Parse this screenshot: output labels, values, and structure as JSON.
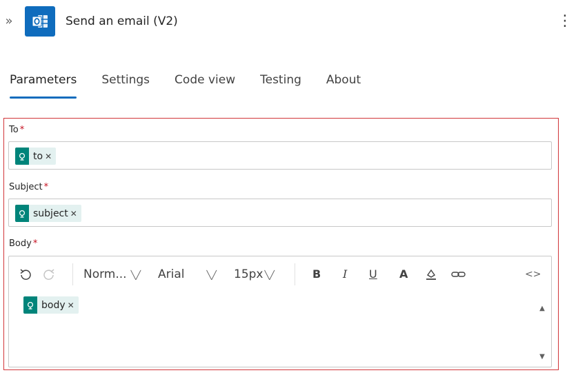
{
  "header": {
    "title": "Send an email (V2)",
    "expand_icon": "double-chevron-right-icon",
    "app_icon": "outlook-icon",
    "more_icon": "more-vertical-icon",
    "app_color": "#0f6cbd"
  },
  "tabs": [
    {
      "label": "Parameters",
      "active": true
    },
    {
      "label": "Settings",
      "active": false
    },
    {
      "label": "Code view",
      "active": false
    },
    {
      "label": "Testing",
      "active": false
    },
    {
      "label": "About",
      "active": false
    }
  ],
  "form": {
    "to": {
      "label": "To",
      "required_mark": "*",
      "token": "to"
    },
    "subject": {
      "label": "Subject",
      "required_mark": "*",
      "token": "subject"
    },
    "body": {
      "label": "Body",
      "required_mark": "*",
      "token": "body"
    }
  },
  "toolbar": {
    "undo_icon": "undo-icon",
    "redo_icon": "redo-icon",
    "block_format": "Norm...",
    "font_family": "Arial",
    "font_size": "15px",
    "bold_label": "B",
    "italic_label": "I",
    "underline_label": "U",
    "font_color_label": "A",
    "highlight_icon": "highlight-icon",
    "link_icon": "link-icon",
    "code_view_label": "<>"
  },
  "colors": {
    "accent": "#0f6cbd",
    "token_icon": "#00847a",
    "token_bg": "#e3f1f0",
    "required": "#c50f1f",
    "highlight_border": "#d13438"
  }
}
